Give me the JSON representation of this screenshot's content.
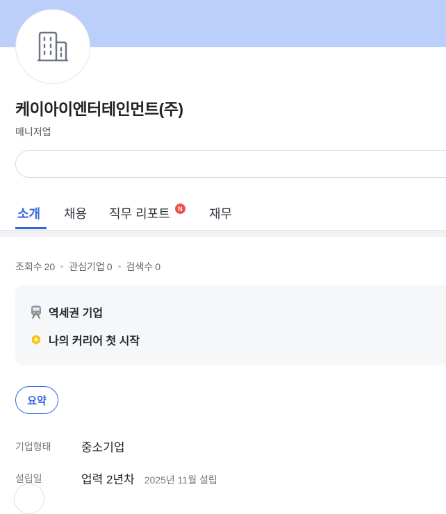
{
  "header": {
    "banner_color": "#bccffa",
    "logo_icon": "building-icon"
  },
  "company": {
    "name": "케이아이엔터테인먼트(주)",
    "industry": "매니저업"
  },
  "tabs": [
    {
      "label": "소개",
      "active": true
    },
    {
      "label": "채용",
      "active": false
    },
    {
      "label": "직무 리포트",
      "active": false,
      "badge": "N"
    },
    {
      "label": "재무",
      "active": false
    }
  ],
  "stats": [
    {
      "label": "조회수",
      "value": "20"
    },
    {
      "label": "관심기업",
      "value": "0"
    },
    {
      "label": "검색수",
      "value": "0"
    }
  ],
  "features": [
    {
      "icon": "train-icon",
      "label": "역세권 기업"
    },
    {
      "icon": "hexagon-badge-icon",
      "label": "나의 커리어 첫 시작"
    }
  ],
  "summary_chip": "요약",
  "info": [
    {
      "label": "기업형태",
      "value": "중소기업",
      "sub": ""
    },
    {
      "label": "설립일",
      "value": "업력 2년차",
      "sub": "2025년 11월 설립"
    }
  ],
  "colors": {
    "accent": "#3366e0",
    "badge": "#f0514c"
  }
}
